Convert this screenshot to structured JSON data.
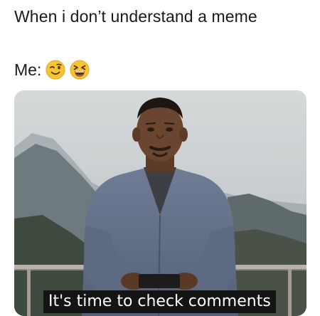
{
  "post": {
    "caption": "When i don’t understand a meme",
    "me_label": "Me:",
    "emojis": [
      "winking-face-icon",
      "squinting-face-icon"
    ]
  },
  "meme": {
    "subtitle": "It's time to check comments"
  }
}
